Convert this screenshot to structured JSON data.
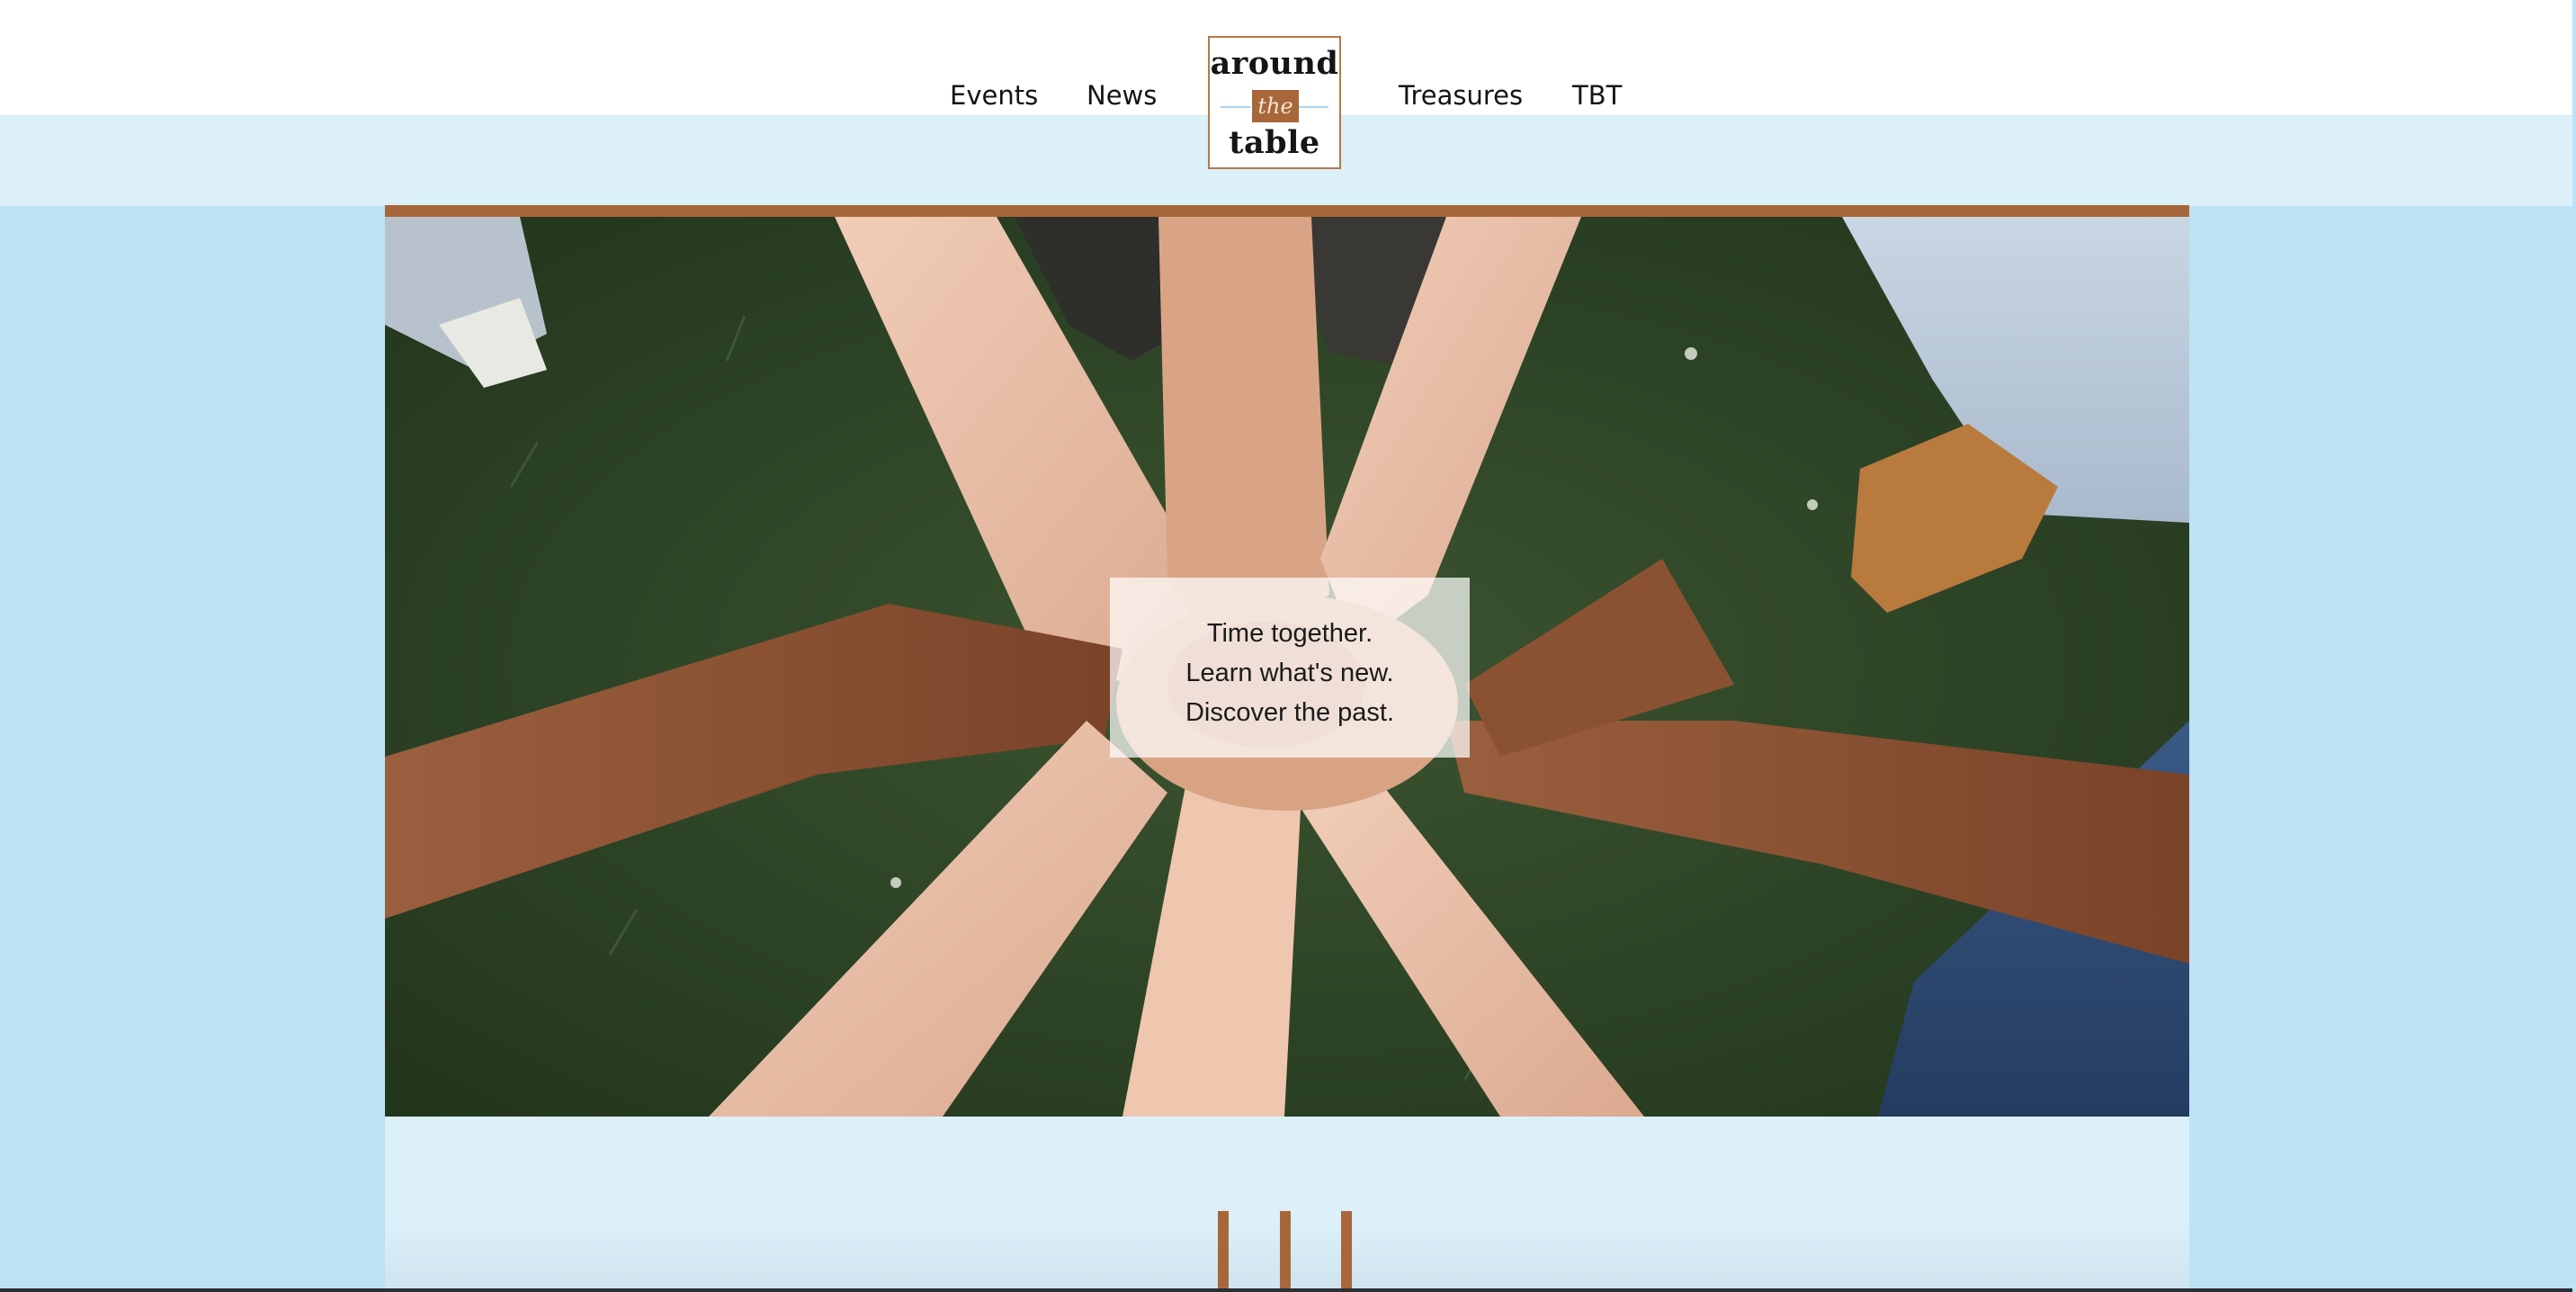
{
  "nav": {
    "items": [
      "Events",
      "News",
      "Treasures",
      "TBT"
    ]
  },
  "logo": {
    "top": "around",
    "middle": "the",
    "bottom": "table"
  },
  "hero": {
    "image_description_icon": "hands-together-on-grass-photo",
    "tagline": [
      "Time together.",
      "Learn what's new.",
      "Discover the past."
    ]
  },
  "colors": {
    "accent": "#a8673a",
    "page_bg": "#bde2f5",
    "band_bg": "#dcf0fa",
    "logo_border": "#b97747"
  }
}
